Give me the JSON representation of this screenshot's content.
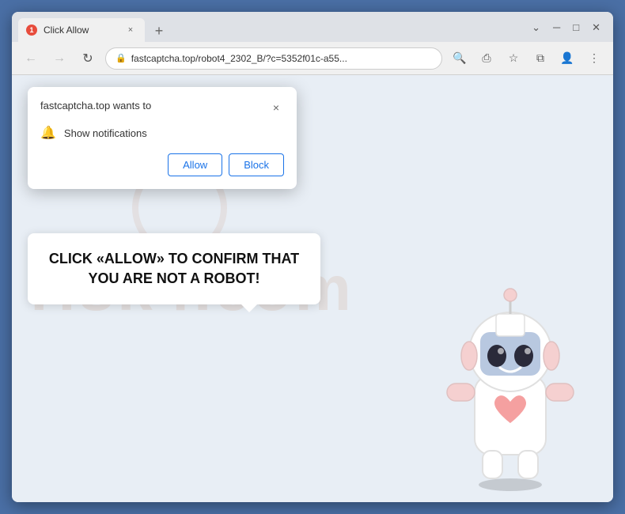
{
  "window": {
    "title": "Click Allow",
    "new_tab_label": "+",
    "tab_close": "×"
  },
  "window_controls": {
    "chevron_down": "⌄",
    "minimize": "─",
    "maximize": "□",
    "close": "✕"
  },
  "nav": {
    "back": "←",
    "forward": "→",
    "reload": "↻"
  },
  "address_bar": {
    "lock": "🔒",
    "url": "fastcaptcha.top/robot4_2302_B/?c=5352f01c-a55...",
    "search_icon": "🔍",
    "share_icon": "⎙",
    "bookmark_icon": "☆",
    "split_icon": "⧉",
    "profile_icon": "👤",
    "menu_icon": "⋮"
  },
  "popup": {
    "title": "fastcaptcha.top wants to",
    "close": "×",
    "notification_icon": "🔔",
    "notification_text": "Show notifications",
    "allow_label": "Allow",
    "block_label": "Block"
  },
  "bubble": {
    "text": "CLICK «ALLOW» TO CONFIRM THAT YOU ARE NOT A ROBOT!"
  },
  "watermark": {
    "text": "risk4.com"
  },
  "colors": {
    "browser_border": "#4a6fa5",
    "title_bar": "#dee1e6",
    "page_bg": "#e8eef5",
    "allow_btn": "#1a73e8",
    "block_btn": "#1a73e8"
  }
}
